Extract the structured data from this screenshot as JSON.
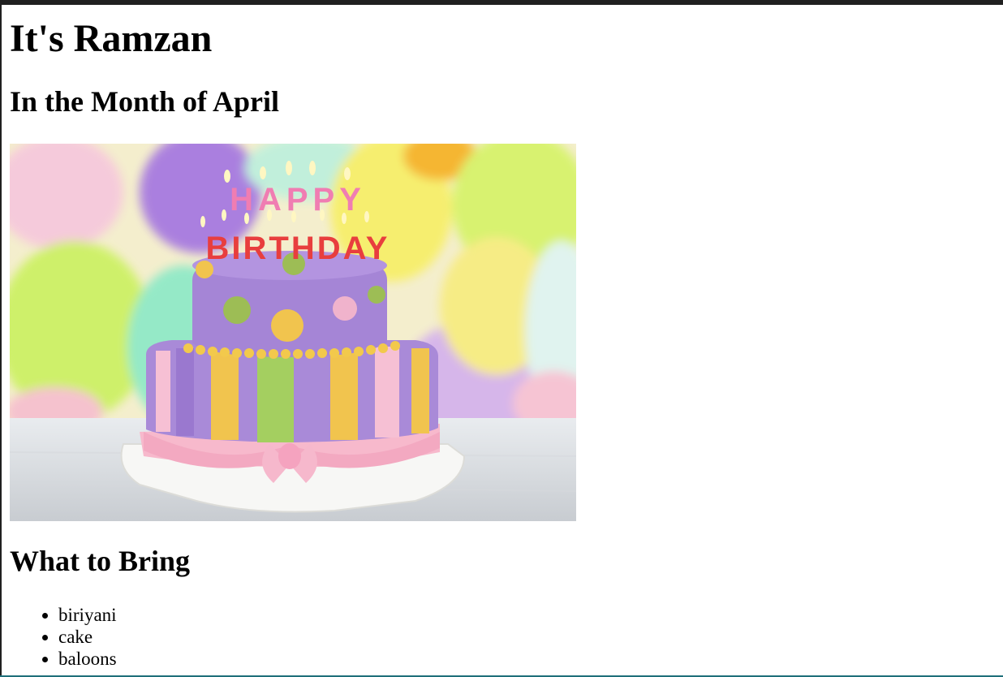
{
  "page": {
    "title": "It's Ramzan",
    "subtitle": "In the Month of April",
    "section_heading": "What to Bring"
  },
  "image": {
    "alt": "Birthday cake",
    "candles_row1": "HAPPY",
    "candles_row2": "BIRTHDAY"
  },
  "list": {
    "items": [
      "biriyani",
      "cake",
      "baloons"
    ]
  }
}
